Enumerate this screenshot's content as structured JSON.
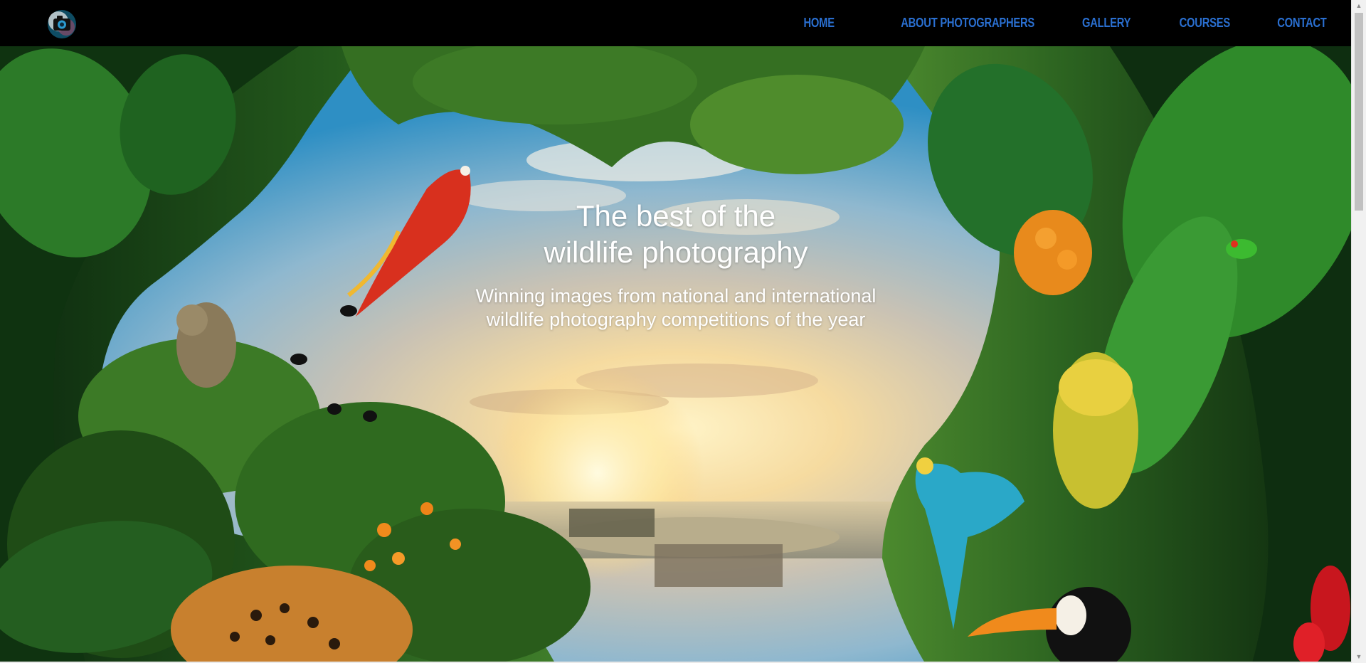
{
  "header": {
    "logo": {
      "icon": "camera-logo-icon"
    },
    "nav": [
      {
        "label": "HOME"
      },
      {
        "label": "ABOUT PHOTOGRAPHERS"
      },
      {
        "label": "GALLERY"
      },
      {
        "label": "COURSES"
      },
      {
        "label": "CONTACT"
      }
    ],
    "nav_color": "#2a6fd0"
  },
  "hero": {
    "headline_line1": "The best of the",
    "headline_line2": "wildlife photography",
    "subline_line1": "Winning images from national and international",
    "subline_line2": "wildlife photography competitions of the year"
  },
  "scrollbar": {
    "up_icon": "scroll-up-arrow-icon",
    "down_icon": "scroll-down-arrow-icon"
  }
}
